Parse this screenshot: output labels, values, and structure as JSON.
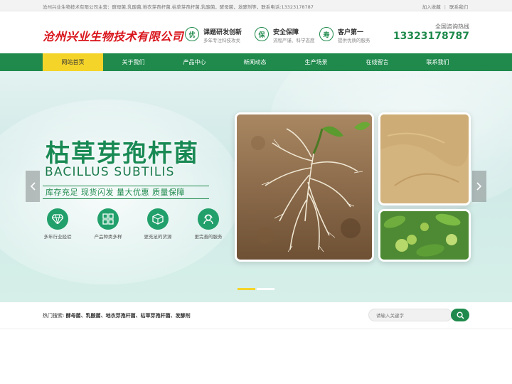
{
  "topbar": {
    "intro": "沧州兴业生物技术有限公司主营：酵母菌,乳酸菌,地衣芽孢杆菌,枯草芽孢杆菌,乳酸菌，酵母菌，发酵剂等，联系电话:13323178787",
    "favorite": "加入收藏",
    "contact": "联系我们"
  },
  "header": {
    "logo": "沧州兴业生物技术有限公司",
    "features": [
      {
        "badge": "优",
        "title": "课题研发创新",
        "sub": "多年专注科技攻关"
      },
      {
        "badge": "保",
        "title": "安全保障",
        "sub": "流程严谨、科学态度"
      },
      {
        "badge": "寿",
        "title": "客户第一",
        "sub": "提供优质的服务"
      }
    ],
    "hotline_label": "全国咨询热线",
    "hotline": "13323178787"
  },
  "nav": {
    "items": [
      "网站首页",
      "关于我们",
      "产品中心",
      "新闻动态",
      "生产场景",
      "在线留言",
      "联系我们"
    ],
    "active_index": 0
  },
  "banner": {
    "title": "枯草芽孢杆菌",
    "subtitle": "BACILLUS SUBTILIS",
    "slogan": "库存充足  现货闪发  量大优惠  质量保障",
    "features": [
      "多年行业经验",
      "产品种类多样",
      "更充足的货源",
      "更完善的服务"
    ],
    "slides_total": 2,
    "slide_active": 1
  },
  "search": {
    "hot_label": "热门搜索:",
    "hot_terms": "酵母菌、乳酸菌、地衣芽孢杆菌、枯草芽孢杆菌、发酵剂",
    "placeholder": "请输入关键字"
  },
  "colors": {
    "brand_green": "#1f8a4c",
    "nav_active": "#f5d42a",
    "logo_red": "#d9141b"
  }
}
